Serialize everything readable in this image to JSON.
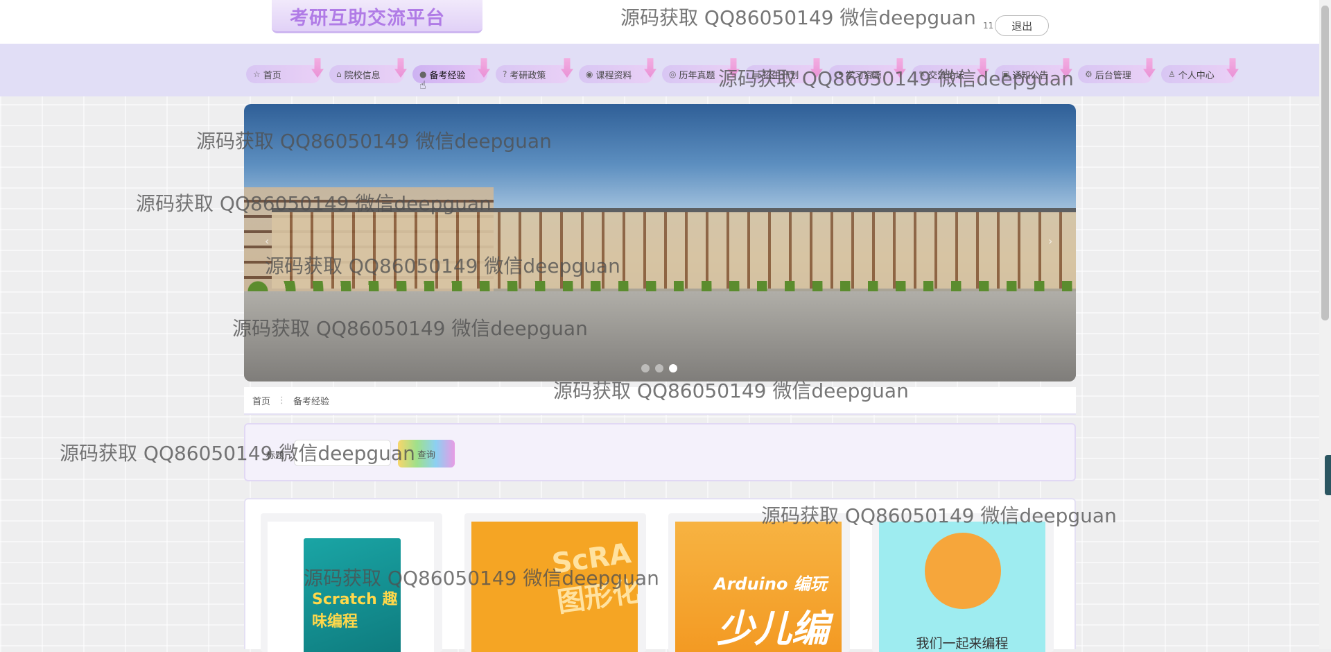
{
  "header": {
    "brand_title": "考研互助交流平台",
    "username": "11",
    "logout_label": "退出"
  },
  "nav": {
    "items": [
      {
        "icon": "☆",
        "label": "首页"
      },
      {
        "icon": "⌂",
        "label": "院校信息"
      },
      {
        "icon": "●",
        "label": "备考经验"
      },
      {
        "icon": "?",
        "label": "考研政策"
      },
      {
        "icon": "◉",
        "label": "课程资料"
      },
      {
        "icon": "◎",
        "label": "历年真题"
      },
      {
        "icon": "▤",
        "label": "招生计划"
      },
      {
        "icon": "◔",
        "label": "学习资源"
      },
      {
        "icon": "✎",
        "label": "交流论坛"
      },
      {
        "icon": "▣",
        "label": "通知公告"
      },
      {
        "icon": "⚙",
        "label": "后台管理"
      },
      {
        "icon": "♙",
        "label": "个人中心"
      }
    ],
    "active_index": 2
  },
  "banner": {
    "prev": "‹",
    "next": "›",
    "slide_count": 3,
    "active_slide": 3
  },
  "breadcrumb": {
    "home": "首页",
    "separator": "⋮",
    "current": "备考经验"
  },
  "search": {
    "label": "标题",
    "input_value": "",
    "button_label": "查询"
  },
  "cards": [
    {
      "image_text": "Scratch 趣味编程"
    },
    {
      "image_text": "ScRA 图形化"
    },
    {
      "image_text_1": "Arduino 编玩",
      "image_text_2": "少儿编"
    },
    {
      "caption": "我们一起来编程"
    }
  ],
  "watermark": "源码获取 QQ86050149 微信deepguan",
  "colors": {
    "brand": "#b07be6",
    "nav_bg": "#e1def6",
    "accent_pink": "#e98bd2"
  }
}
